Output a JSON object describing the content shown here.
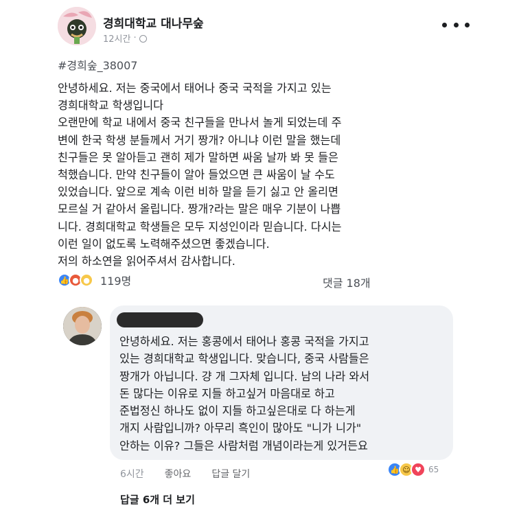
{
  "page": {
    "name": "경희대학교 대나무숲",
    "time": "12시간",
    "separator": "·"
  },
  "post": {
    "hashtag": "#경희숲_38007",
    "lines": [
      "안녕하세요. 저는 중국에서 태어나 중국 국적을 가지고 있는",
      "경희대학교 학생입니다",
      "오랜만에 학교 내에서 중국 친구들을 만나서 놀게 되었는데 주",
      "변에 한국 학생 분들께서 거기 짱개? 아니냐 이런 말을 했는데",
      "친구들은 못 알아듣고 괜히 제가 말하면 싸움 날까 봐 못 들은",
      "척했습니다. 만약 친구들이 알아 들었으면 큰 싸움이 날 수도",
      "있었습니다. 앞으로 계속 이런 비하 말을 듣기 싫고 안 올리면",
      "모르실 거 같아서 올립니다. 짱개?라는 말은 매우 기분이 나쁩",
      "니다. 경희대학교 학생들은 모두 지성인이라 믿습니다. 다시는",
      "이런 일이 없도록 노력해주셨으면 좋겠습니다.",
      "저의 하소연을 읽어주셔서 감사합니다."
    ],
    "reactions": {
      "icons": [
        "like-icon",
        "angry-icon",
        "sad-icon"
      ],
      "count": "119명"
    },
    "comment_count": "댓글 18개"
  },
  "comment": {
    "lines": [
      "안녕하세요. 저는 홍콩에서 태어나 홍콩 국적을 가지고",
      "있는 경희대학교 학생입니다. 맞습니다, 중국 사람들은",
      "짱개가 아닙니다. 걍 개 그자체 입니다. 남의 나라 와서",
      "돈 많다는 이유로 지들 하고싶거 마음대로 하고",
      "준법정신 하나도 없이 지들 하고싶은대로 다 하는게",
      "개지 사람입니까? 아무리 흑인이 많아도 \"니가 니가\"",
      "안하는 이유? 그들은 사람처럼 개념이라는게 있거든요"
    ],
    "time": "6시간",
    "like_label": "좋아요",
    "reply_label": "답글 달기",
    "reactions": {
      "icons": [
        "like-icon",
        "haha-icon",
        "love-icon"
      ],
      "count": "65"
    }
  },
  "more_replies": "답글 6개 더 보기",
  "colors": {
    "accent_blue": "#3b86f7",
    "muted_text": "#90949c",
    "bubble_bg": "#f0f2f5"
  }
}
